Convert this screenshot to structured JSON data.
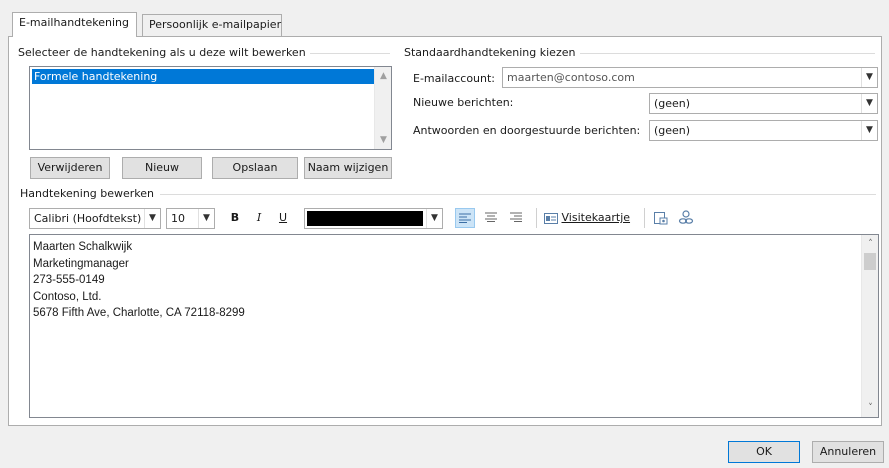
{
  "tabs": [
    {
      "label": "E-mailhandtekening",
      "active": true
    },
    {
      "label": "Persoonlijk e-mailpapier",
      "active": false
    }
  ],
  "select_section": {
    "label": "Selecteer de handtekening als u deze wilt bewerken",
    "signatures": [
      "Formele handtekening"
    ],
    "selected_index": 0
  },
  "buttons": {
    "delete": "Verwijderen",
    "new": "Nieuw",
    "save": "Opslaan",
    "rename": "Naam wijzigen"
  },
  "default_section": {
    "label": "Standaardhandtekening kiezen",
    "email_account_label": "E-mailaccount:",
    "email_account_value": "maarten@contoso.com",
    "new_messages_label": "Nieuwe berichten:",
    "new_messages_value": "(geen)",
    "replies_label": "Antwoorden en doorgestuurde berichten:",
    "replies_value": "(geen)"
  },
  "edit_section": {
    "label": "Handtekening bewerken",
    "font": "Calibri (Hoofdtekst)",
    "size": "10",
    "bold": "B",
    "italic": "I",
    "underline": "U",
    "font_color": "#000000",
    "business_card": "Visitekaartje",
    "selected_alignment": "left"
  },
  "signature_lines": [
    "Maarten Schalkwijk",
    "Marketingmanager",
    "273-555-0149",
    "Contoso, Ltd.",
    "5678 Fifth Ave, Charlotte, CA 72118-8299"
  ],
  "footer": {
    "ok": "OK",
    "cancel": "Annuleren"
  },
  "colors": {
    "accent": "#0078d7",
    "dialog_bg": "#f0f0f0"
  }
}
